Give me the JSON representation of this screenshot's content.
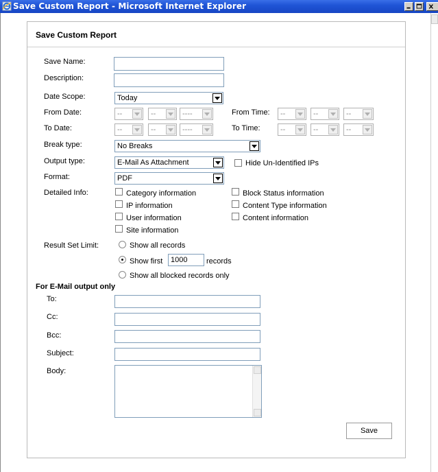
{
  "window": {
    "title": "Save Custom Report - Microsoft Internet Explorer"
  },
  "panel": {
    "title": "Save Custom Report"
  },
  "fields": {
    "save_name": {
      "label": "Save Name:",
      "value": ""
    },
    "description": {
      "label": "Description:",
      "value": ""
    },
    "date_scope": {
      "label": "Date Scope:",
      "value": "Today"
    },
    "from_date": {
      "label": "From Date:",
      "month": "--",
      "day": "--",
      "year": "----"
    },
    "from_time": {
      "label": "From Time:",
      "hour": "--",
      "minute": "--",
      "ampm": "--"
    },
    "to_date": {
      "label": "To Date:",
      "month": "--",
      "day": "--",
      "year": "----"
    },
    "to_time": {
      "label": "To Time:",
      "hour": "--",
      "minute": "--",
      "ampm": "--"
    },
    "break_type": {
      "label": "Break type:",
      "value": "No Breaks"
    },
    "output_type": {
      "label": "Output type:",
      "value": "E-Mail As Attachment"
    },
    "hide_unidentified": {
      "label": "Hide Un-Identified IPs",
      "checked": false
    },
    "format": {
      "label": "Format:",
      "value": "PDF"
    }
  },
  "detailed_info": {
    "label": "Detailed Info:",
    "options": [
      {
        "label": "Category information",
        "checked": false
      },
      {
        "label": "IP information",
        "checked": false
      },
      {
        "label": "User information",
        "checked": false
      },
      {
        "label": "Site information",
        "checked": false
      },
      {
        "label": "Block Status information",
        "checked": false
      },
      {
        "label": "Content Type information",
        "checked": false
      },
      {
        "label": "Content information",
        "checked": false
      }
    ]
  },
  "result_set": {
    "label": "Result Set Limit:",
    "show_all": "Show all records",
    "show_first_prefix": "Show first",
    "show_first_value": "1000",
    "show_first_suffix": "records",
    "show_blocked": "Show all blocked records only",
    "selected": "show_first"
  },
  "email": {
    "heading": "For E-Mail output only",
    "to": {
      "label": "To:",
      "value": ""
    },
    "cc": {
      "label": "Cc:",
      "value": ""
    },
    "bcc": {
      "label": "Bcc:",
      "value": ""
    },
    "subject": {
      "label": "Subject:",
      "value": ""
    },
    "body": {
      "label": "Body:",
      "value": ""
    }
  },
  "actions": {
    "save_label": "Save"
  },
  "colors": {
    "titlebar": "#1f54d6",
    "input_border": "#7f9db9",
    "panel_border": "#b9b9b9"
  }
}
